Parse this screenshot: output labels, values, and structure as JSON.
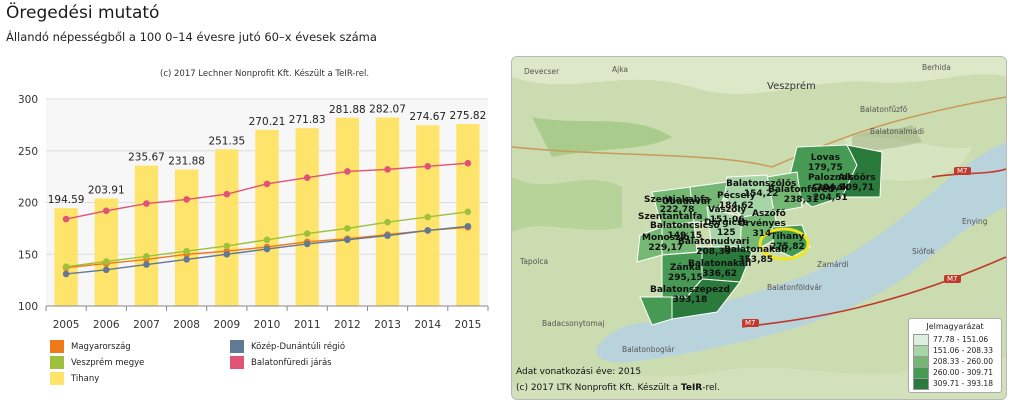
{
  "header": {
    "title": "Öregedési mutató",
    "subtitle": "Állandó népességből a 100 0–14 évesre jutó 60–x évesek száma"
  },
  "chart_credit": "(c) 2017 Lechner Nonprofit Kft. Készült a TeIR-rel.",
  "chart_data": {
    "type": "bar",
    "categories": [
      "2005",
      "2006",
      "2007",
      "2008",
      "2009",
      "2010",
      "2011",
      "2012",
      "2013",
      "2014",
      "2015"
    ],
    "ylim": [
      100,
      300
    ],
    "yticks": [
      100,
      150,
      200,
      250,
      300
    ],
    "grid": true,
    "bar_series": {
      "name": "Tihany",
      "color": "#ffe46b",
      "values": [
        194.59,
        203.91,
        235.67,
        231.88,
        251.35,
        270.21,
        271.83,
        281.88,
        282.07,
        274.67,
        275.82
      ],
      "labels": [
        "194.59",
        "203.91",
        "235.67",
        "231.88",
        "251.35",
        "270.21",
        "271.83",
        "281.88",
        "282.07",
        "274.67",
        "275.82"
      ]
    },
    "line_series": [
      {
        "name": "Magyarország",
        "color": "#f07a1a",
        "values": [
          137,
          141,
          145,
          150,
          153,
          157,
          162,
          165,
          169,
          173,
          176
        ]
      },
      {
        "name": "Veszprém megye",
        "color": "#9dc13d",
        "values": [
          138,
          143,
          148,
          153,
          158,
          164,
          170,
          175,
          181,
          186,
          191
        ]
      },
      {
        "name": "Közép-Dunántúli régió",
        "color": "#607a96",
        "values": [
          131,
          135,
          140,
          145,
          150,
          155,
          160,
          164,
          168,
          173,
          177
        ]
      },
      {
        "name": "Balatonfüredi járás",
        "color": "#e05276",
        "values": [
          184,
          192,
          199,
          203,
          208,
          218,
          224,
          230,
          232,
          235,
          238
        ]
      }
    ],
    "legend": [
      {
        "name": "Magyarország",
        "color": "#f07a1a"
      },
      {
        "name": "Közép-Dunántúli régió",
        "color": "#607a96"
      },
      {
        "name": "Veszprém megye",
        "color": "#9dc13d"
      },
      {
        "name": "Balatonfüredi járás",
        "color": "#e05276"
      },
      {
        "name": "Tihany",
        "color": "#ffe46b"
      }
    ],
    "legend_position": "bottom"
  },
  "map": {
    "regions": [
      {
        "name": "Lovas",
        "value": "179,75"
      },
      {
        "name": "Paloznak",
        "value": "204,5"
      },
      {
        "name": "Csopak",
        "value": "204,51"
      },
      {
        "name": "Alsóörs",
        "value": "309,71"
      },
      {
        "name": "Balatonszőlős",
        "value": "154,22"
      },
      {
        "name": "Balatonfüred",
        "value": "238,31"
      },
      {
        "name": "Szentjakabfa",
        "value": "222,78"
      },
      {
        "name": "Óbudavár",
        "value": ""
      },
      {
        "name": "Pécsely",
        "value": "184,62"
      },
      {
        "name": "Vászoly",
        "value": "151,06"
      },
      {
        "name": "Dörgicse",
        "value": "125"
      },
      {
        "name": "Aszófő",
        "value": ""
      },
      {
        "name": "Örvényes",
        "value": "314"
      },
      {
        "name": "Balatoncsicsó",
        "value": "149,15"
      },
      {
        "name": "Szentantalfa",
        "value": ""
      },
      {
        "name": "Monoszló",
        "value": "229,17"
      },
      {
        "name": "Balatonudvari",
        "value": "208,33"
      },
      {
        "name": "Tihany",
        "value": "275,82"
      },
      {
        "name": "Balatonakali",
        "value": "353,85"
      },
      {
        "name": "Zánka",
        "value": "295,15"
      },
      {
        "name": "Balatonakali",
        "value": "336,62"
      },
      {
        "name": "Balatonszepezd",
        "value": "393,18"
      }
    ],
    "places": [
      "Devecser",
      "Ajka",
      "Berhida",
      "Veszprém",
      "Balatonfűzfő",
      "Balatonalmádi",
      "Enying",
      "Siófok",
      "Tapolca",
      "Zamárdi",
      "Balatonföldvár",
      "Badacsonytomaj",
      "Balatonboglár"
    ],
    "roads": [
      "M7",
      "M7",
      "M7"
    ],
    "legend": {
      "title": "Jelmagyarázat",
      "items": [
        {
          "label": "77.78 - 151.06",
          "color": "#dcefdc"
        },
        {
          "label": "151.06 - 208.33",
          "color": "#a8d5a8"
        },
        {
          "label": "208.33 - 260.00",
          "color": "#74b874"
        },
        {
          "label": "260.00 - 309.71",
          "color": "#469a54"
        },
        {
          "label": "309.71 - 393.18",
          "color": "#2a7a3c"
        }
      ]
    },
    "footer_year": "Adat vonatkozási éve: 2015",
    "footer_credit_prefix": "(c) 2017 LTK Nonprofit Kft. Készült a ",
    "footer_credit_brand": "TeIR",
    "footer_credit_suffix": "-rel."
  }
}
